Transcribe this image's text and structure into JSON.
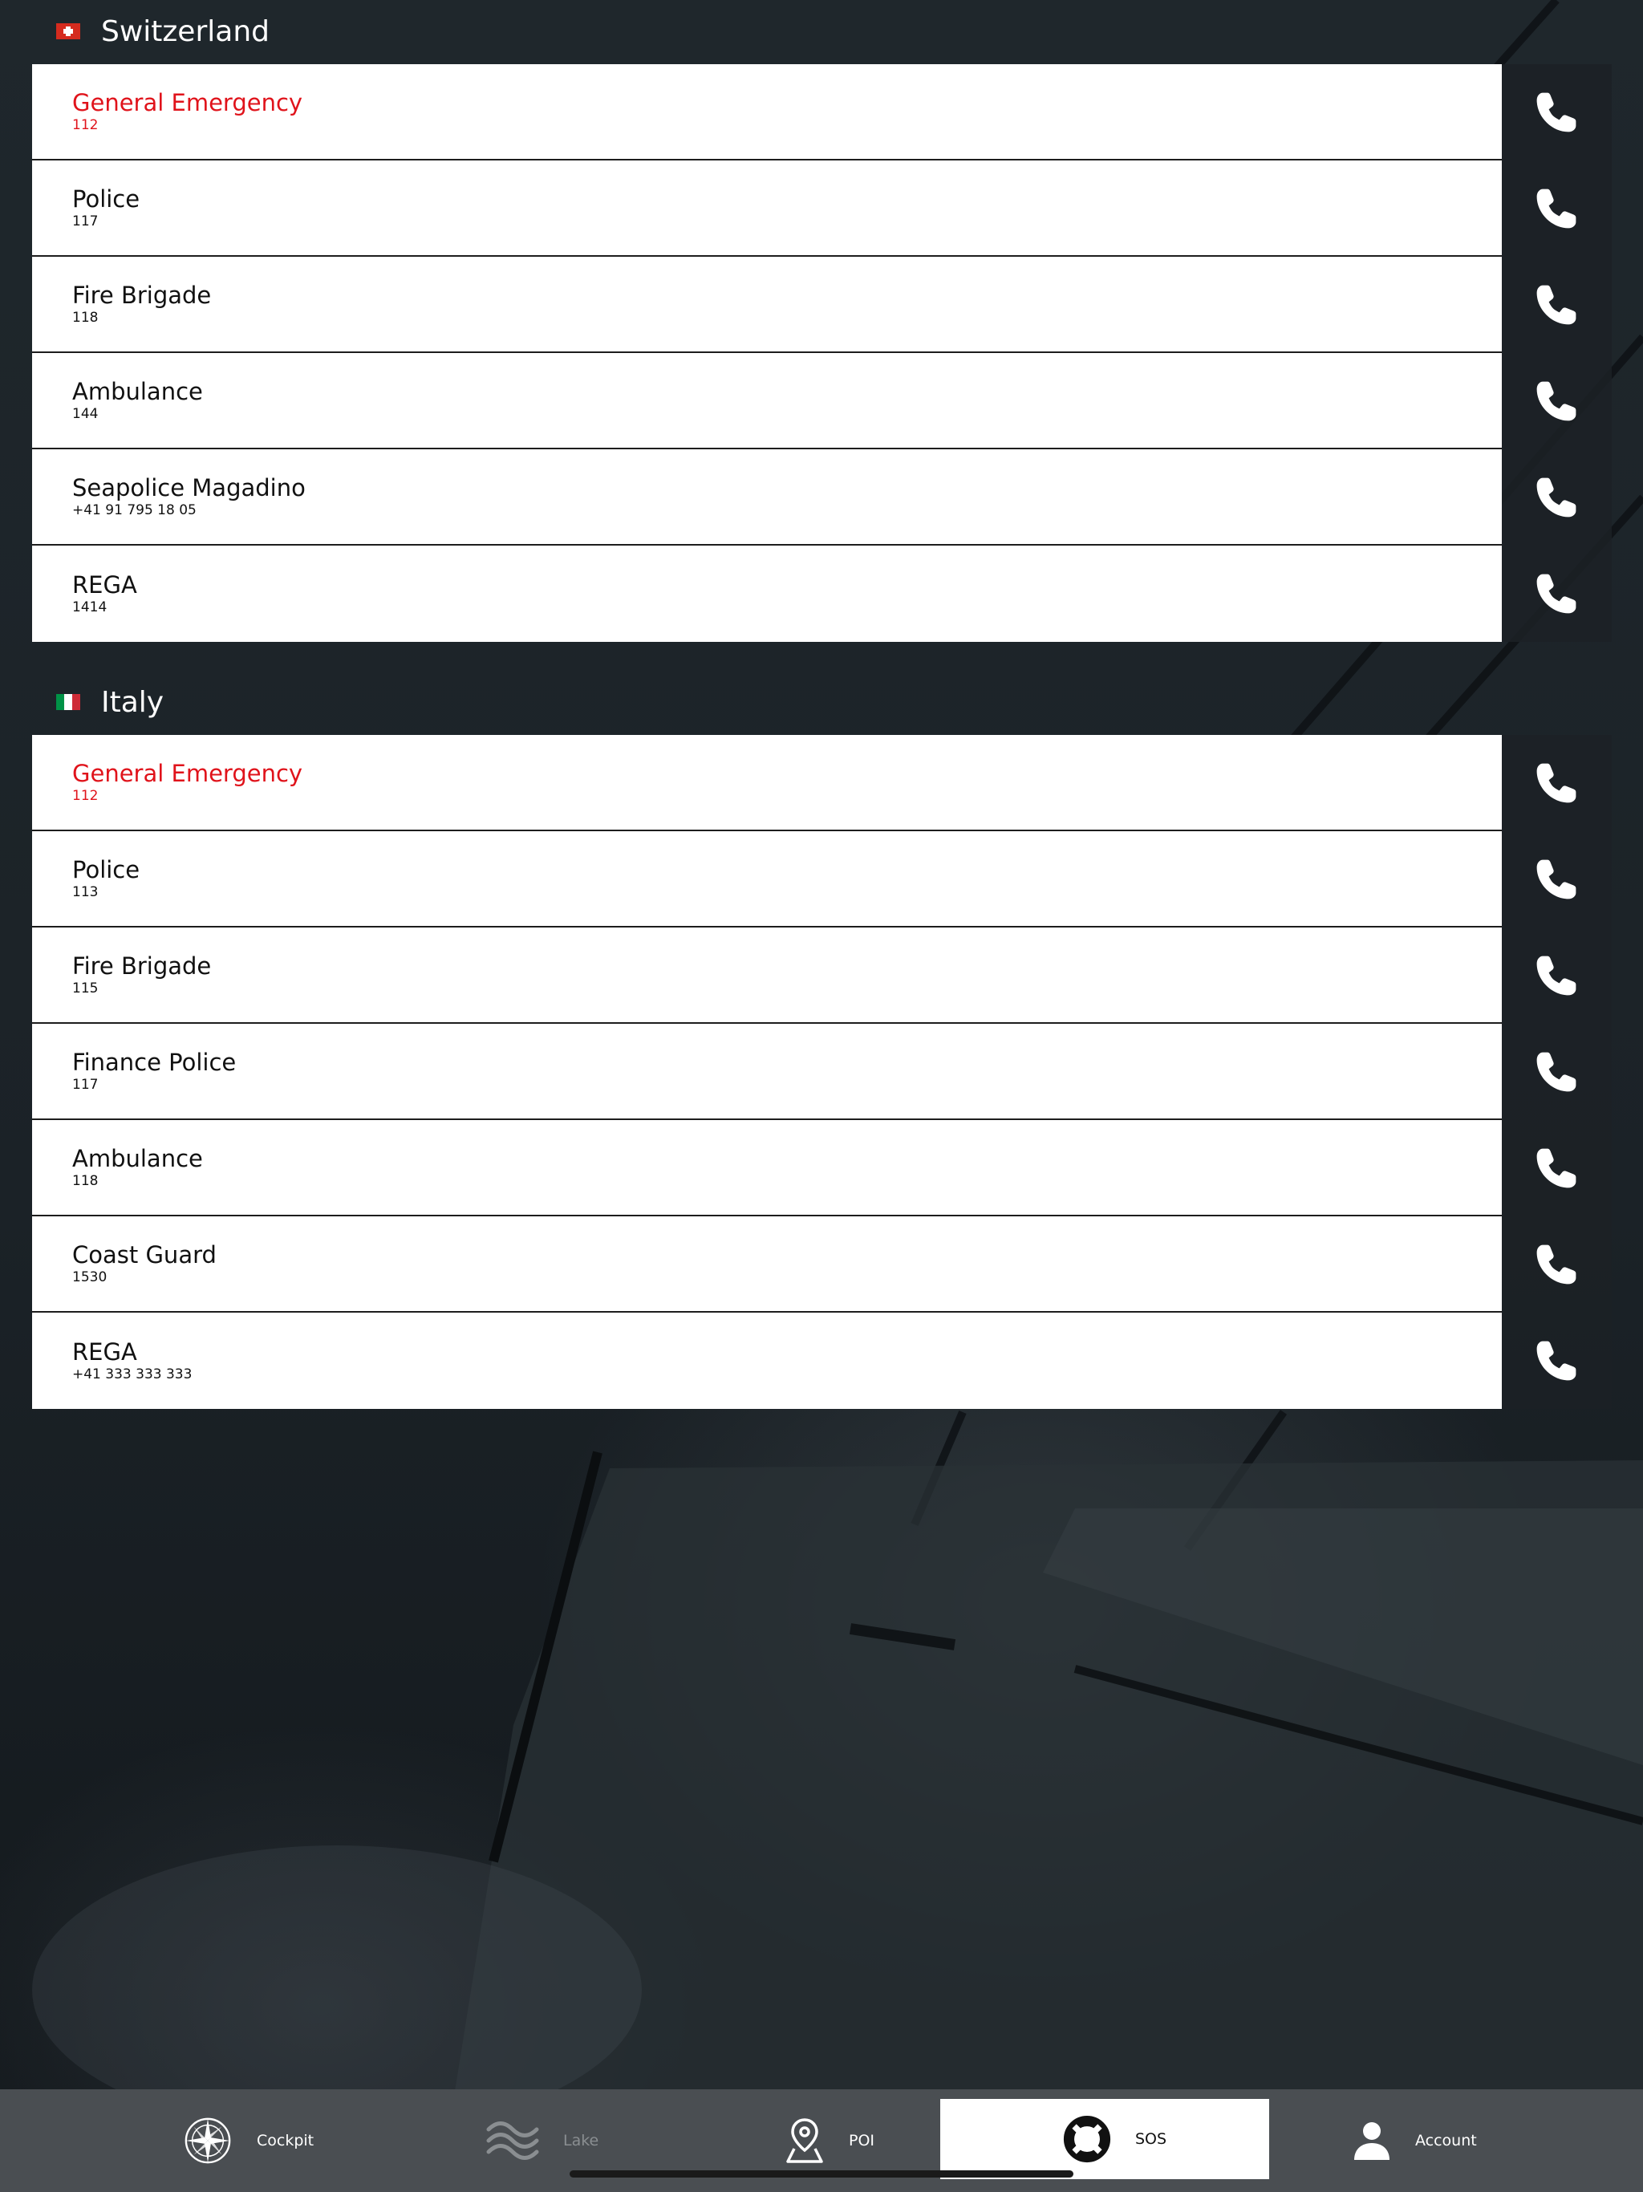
{
  "sections": [
    {
      "country": "Switzerland",
      "flag": "swiss-flag-icon",
      "contacts": [
        {
          "name": "General Emergency",
          "number": "112",
          "emergency": true
        },
        {
          "name": "Police",
          "number": "117",
          "emergency": false
        },
        {
          "name": "Fire Brigade",
          "number": "118",
          "emergency": false
        },
        {
          "name": "Ambulance",
          "number": "144",
          "emergency": false
        },
        {
          "name": "Seapolice Magadino",
          "number": "+41 91 795 18 05",
          "emergency": false
        },
        {
          "name": "REGA",
          "number": "1414",
          "emergency": false
        }
      ]
    },
    {
      "country": "Italy",
      "flag": "italian-flag-icon",
      "contacts": [
        {
          "name": "General Emergency",
          "number": "112",
          "emergency": true
        },
        {
          "name": "Police",
          "number": "113",
          "emergency": false
        },
        {
          "name": "Fire Brigade",
          "number": "115",
          "emergency": false
        },
        {
          "name": "Finance Police",
          "number": "117",
          "emergency": false
        },
        {
          "name": "Ambulance",
          "number": "118",
          "emergency": false
        },
        {
          "name": "Coast Guard",
          "number": "1530",
          "emergency": false
        },
        {
          "name": "REGA",
          "number": "+41 333 333 333",
          "emergency": false
        }
      ]
    }
  ],
  "tab_bar": {
    "tabs": [
      {
        "label": "Cockpit",
        "icon": "compass-rose-icon",
        "state": "normal"
      },
      {
        "label": "Lake",
        "icon": "waves-icon",
        "state": "disabled"
      },
      {
        "label": "POI",
        "icon": "map-pin-icon",
        "state": "normal"
      },
      {
        "label": "SOS",
        "icon": "lifebuoy-icon",
        "state": "active"
      },
      {
        "label": "Account",
        "icon": "user-icon",
        "state": "normal"
      }
    ]
  },
  "colors": {
    "emergency_text": "#e0131b",
    "background": "#1d2429",
    "tab_bar": "#4a4e52",
    "active_tab": "#ffffff"
  }
}
